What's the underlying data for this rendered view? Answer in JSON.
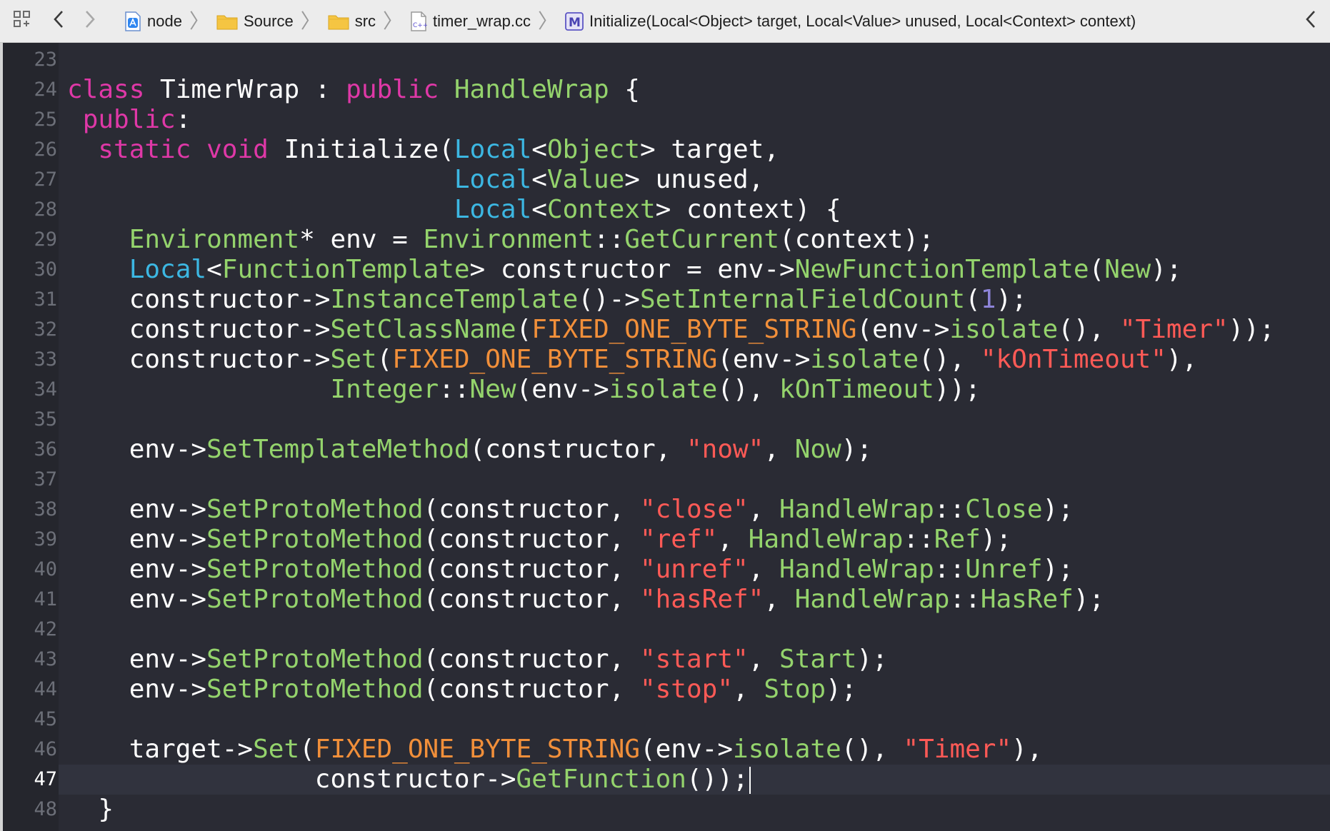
{
  "colors": {
    "plain": "#ffffff",
    "keyword": "#df38a7",
    "type": "#94d36c",
    "builtin_type": "#3cb7e2",
    "method": "#94d36c",
    "macro": "#f18f3a",
    "string": "#ff5a56",
    "number": "#8d84d8",
    "gutter_text": "#6c6f78",
    "gutter_current": "#ffffff"
  },
  "breadcrumbs": [
    {
      "icon": "app-project-icon",
      "label": "node"
    },
    {
      "icon": "folder-icon",
      "label": "Source"
    },
    {
      "icon": "folder-icon",
      "label": "src"
    },
    {
      "icon": "cpp-file-icon",
      "label": "timer_wrap.cc"
    },
    {
      "icon": "method-m-icon",
      "label": "Initialize(Local<Object> target, Local<Value> unused, Local<Context> context)"
    }
  ],
  "toolbar": {
    "related_items_icon": "grid-icon",
    "back_icon": "chevron-left-icon",
    "forward_icon": "chevron-right-icon",
    "right_icon": "chevron-left-icon"
  },
  "editor": {
    "current_line": 47,
    "lines": [
      {
        "num": "23",
        "tokens": []
      },
      {
        "num": "24",
        "tokens": [
          [
            "kw",
            "class"
          ],
          [
            "p",
            " TimerWrap : "
          ],
          [
            "kw",
            "public"
          ],
          [
            "p",
            " "
          ],
          [
            "ty",
            "HandleWrap"
          ],
          [
            "p",
            " {"
          ]
        ]
      },
      {
        "num": "25",
        "tokens": [
          [
            "p",
            " "
          ],
          [
            "kw",
            "public"
          ],
          [
            "p",
            ":"
          ]
        ]
      },
      {
        "num": "26",
        "tokens": [
          [
            "p",
            "  "
          ],
          [
            "kw",
            "static"
          ],
          [
            "p",
            " "
          ],
          [
            "kw",
            "void"
          ],
          [
            "p",
            " Initialize("
          ],
          [
            "bt",
            "Local"
          ],
          [
            "p",
            "<"
          ],
          [
            "ty",
            "Object"
          ],
          [
            "p",
            "> target,"
          ]
        ]
      },
      {
        "num": "27",
        "tokens": [
          [
            "p",
            "                         "
          ],
          [
            "bt",
            "Local"
          ],
          [
            "p",
            "<"
          ],
          [
            "ty",
            "Value"
          ],
          [
            "p",
            "> unused,"
          ]
        ]
      },
      {
        "num": "28",
        "tokens": [
          [
            "p",
            "                         "
          ],
          [
            "bt",
            "Local"
          ],
          [
            "p",
            "<"
          ],
          [
            "ty",
            "Context"
          ],
          [
            "p",
            "> context) {"
          ]
        ]
      },
      {
        "num": "29",
        "tokens": [
          [
            "p",
            "    "
          ],
          [
            "ty",
            "Environment"
          ],
          [
            "p",
            "* env = "
          ],
          [
            "ty",
            "Environment"
          ],
          [
            "p",
            "::"
          ],
          [
            "me",
            "GetCurrent"
          ],
          [
            "p",
            "(context);"
          ]
        ]
      },
      {
        "num": "30",
        "tokens": [
          [
            "p",
            "    "
          ],
          [
            "bt",
            "Local"
          ],
          [
            "p",
            "<"
          ],
          [
            "ty",
            "FunctionTemplate"
          ],
          [
            "p",
            "> constructor = env->"
          ],
          [
            "me",
            "NewFunctionTemplate"
          ],
          [
            "p",
            "("
          ],
          [
            "me",
            "New"
          ],
          [
            "p",
            ");"
          ]
        ]
      },
      {
        "num": "31",
        "tokens": [
          [
            "p",
            "    constructor->"
          ],
          [
            "me",
            "InstanceTemplate"
          ],
          [
            "p",
            "()->"
          ],
          [
            "me",
            "SetInternalFieldCount"
          ],
          [
            "p",
            "("
          ],
          [
            "nu",
            "1"
          ],
          [
            "p",
            ");"
          ]
        ]
      },
      {
        "num": "32",
        "tokens": [
          [
            "p",
            "    constructor->"
          ],
          [
            "me",
            "SetClassName"
          ],
          [
            "p",
            "("
          ],
          [
            "ma",
            "FIXED_ONE_BYTE_STRING"
          ],
          [
            "p",
            "(env->"
          ],
          [
            "me",
            "isolate"
          ],
          [
            "p",
            "(), "
          ],
          [
            "st",
            "\"Timer\""
          ],
          [
            "p",
            "));"
          ]
        ]
      },
      {
        "num": "33",
        "tokens": [
          [
            "p",
            "    constructor->"
          ],
          [
            "me",
            "Set"
          ],
          [
            "p",
            "("
          ],
          [
            "ma",
            "FIXED_ONE_BYTE_STRING"
          ],
          [
            "p",
            "(env->"
          ],
          [
            "me",
            "isolate"
          ],
          [
            "p",
            "(), "
          ],
          [
            "st",
            "\"kOnTimeout\""
          ],
          [
            "p",
            "),"
          ]
        ]
      },
      {
        "num": "34",
        "tokens": [
          [
            "p",
            "                 "
          ],
          [
            "ty",
            "Integer"
          ],
          [
            "p",
            "::"
          ],
          [
            "me",
            "New"
          ],
          [
            "p",
            "(env->"
          ],
          [
            "me",
            "isolate"
          ],
          [
            "p",
            "(), "
          ],
          [
            "me",
            "kOnTimeout"
          ],
          [
            "p",
            "));"
          ]
        ]
      },
      {
        "num": "35",
        "tokens": []
      },
      {
        "num": "36",
        "tokens": [
          [
            "p",
            "    env->"
          ],
          [
            "me",
            "SetTemplateMethod"
          ],
          [
            "p",
            "(constructor, "
          ],
          [
            "st",
            "\"now\""
          ],
          [
            "p",
            ", "
          ],
          [
            "me",
            "Now"
          ],
          [
            "p",
            ");"
          ]
        ]
      },
      {
        "num": "37",
        "tokens": []
      },
      {
        "num": "38",
        "tokens": [
          [
            "p",
            "    env->"
          ],
          [
            "me",
            "SetProtoMethod"
          ],
          [
            "p",
            "(constructor, "
          ],
          [
            "st",
            "\"close\""
          ],
          [
            "p",
            ", "
          ],
          [
            "ty",
            "HandleWrap"
          ],
          [
            "p",
            "::"
          ],
          [
            "me",
            "Close"
          ],
          [
            "p",
            ");"
          ]
        ]
      },
      {
        "num": "39",
        "tokens": [
          [
            "p",
            "    env->"
          ],
          [
            "me",
            "SetProtoMethod"
          ],
          [
            "p",
            "(constructor, "
          ],
          [
            "st",
            "\"ref\""
          ],
          [
            "p",
            ", "
          ],
          [
            "ty",
            "HandleWrap"
          ],
          [
            "p",
            "::"
          ],
          [
            "me",
            "Ref"
          ],
          [
            "p",
            ");"
          ]
        ]
      },
      {
        "num": "40",
        "tokens": [
          [
            "p",
            "    env->"
          ],
          [
            "me",
            "SetProtoMethod"
          ],
          [
            "p",
            "(constructor, "
          ],
          [
            "st",
            "\"unref\""
          ],
          [
            "p",
            ", "
          ],
          [
            "ty",
            "HandleWrap"
          ],
          [
            "p",
            "::"
          ],
          [
            "me",
            "Unref"
          ],
          [
            "p",
            ");"
          ]
        ]
      },
      {
        "num": "41",
        "tokens": [
          [
            "p",
            "    env->"
          ],
          [
            "me",
            "SetProtoMethod"
          ],
          [
            "p",
            "(constructor, "
          ],
          [
            "st",
            "\"hasRef\""
          ],
          [
            "p",
            ", "
          ],
          [
            "ty",
            "HandleWrap"
          ],
          [
            "p",
            "::"
          ],
          [
            "me",
            "HasRef"
          ],
          [
            "p",
            ");"
          ]
        ]
      },
      {
        "num": "42",
        "tokens": []
      },
      {
        "num": "43",
        "tokens": [
          [
            "p",
            "    env->"
          ],
          [
            "me",
            "SetProtoMethod"
          ],
          [
            "p",
            "(constructor, "
          ],
          [
            "st",
            "\"start\""
          ],
          [
            "p",
            ", "
          ],
          [
            "me",
            "Start"
          ],
          [
            "p",
            ");"
          ]
        ]
      },
      {
        "num": "44",
        "tokens": [
          [
            "p",
            "    env->"
          ],
          [
            "me",
            "SetProtoMethod"
          ],
          [
            "p",
            "(constructor, "
          ],
          [
            "st",
            "\"stop\""
          ],
          [
            "p",
            ", "
          ],
          [
            "me",
            "Stop"
          ],
          [
            "p",
            ");"
          ]
        ]
      },
      {
        "num": "45",
        "tokens": []
      },
      {
        "num": "46",
        "tokens": [
          [
            "p",
            "    target->"
          ],
          [
            "me",
            "Set"
          ],
          [
            "p",
            "("
          ],
          [
            "ma",
            "FIXED_ONE_BYTE_STRING"
          ],
          [
            "p",
            "(env->"
          ],
          [
            "me",
            "isolate"
          ],
          [
            "p",
            "(), "
          ],
          [
            "st",
            "\"Timer\""
          ],
          [
            "p",
            "),"
          ]
        ]
      },
      {
        "num": "47",
        "tokens": [
          [
            "p",
            "                constructor->"
          ],
          [
            "me",
            "GetFunction"
          ],
          [
            "p",
            "());"
          ]
        ]
      },
      {
        "num": "48",
        "tokens": [
          [
            "p",
            "  }"
          ]
        ]
      }
    ]
  }
}
